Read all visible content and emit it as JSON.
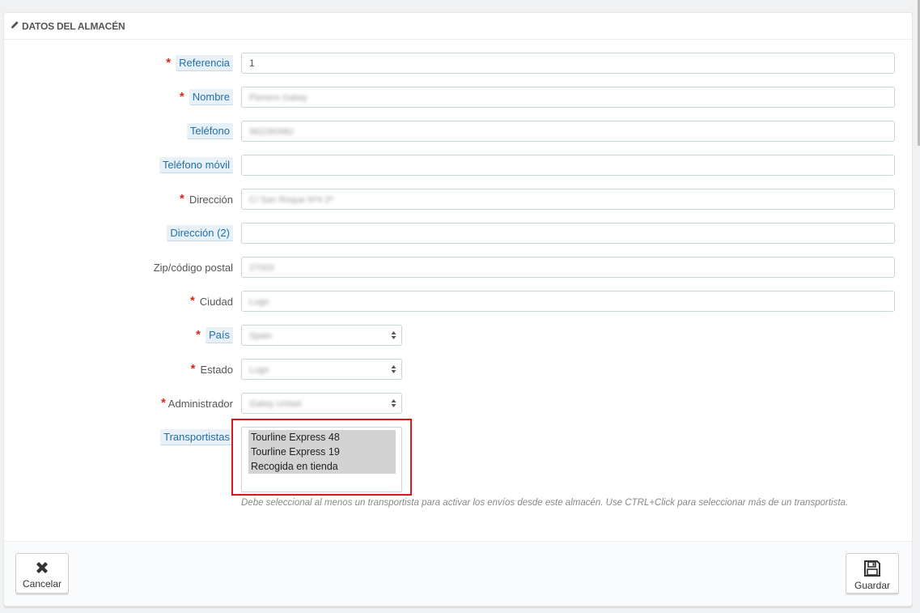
{
  "panel": {
    "title": "DATOS DEL ALMACÉN"
  },
  "fields": {
    "referencia": {
      "label": "Referencia",
      "value": "1"
    },
    "nombre": {
      "label": "Nombre",
      "value": "Pionero Galwy"
    },
    "telefono": {
      "label": "Teléfono",
      "value": "982280982"
    },
    "telefono_movil": {
      "label": "Teléfono móvil",
      "value": ""
    },
    "direccion": {
      "label": "Dirección",
      "value": "C/ San Roque Nº4 2ª"
    },
    "direccion2": {
      "label": "Dirección (2)",
      "value": ""
    },
    "zip": {
      "label": "Zip/código postal",
      "value": "27003"
    },
    "ciudad": {
      "label": "Ciudad",
      "value": "Lugo"
    },
    "pais": {
      "label": "País",
      "value": "Spain"
    },
    "estado": {
      "label": "Estado",
      "value": "Lugo"
    },
    "administrador": {
      "label": "Administrador",
      "value": "Galwy Uniset"
    },
    "transportistas": {
      "label": "Transportistas",
      "options": [
        "Tourline Express 48",
        "Tourline Express 19",
        "Recogida en tienda"
      ],
      "help": "Debe seleccional al menos un transportista para activar los envíos desde este almacén. Use CTRL+Click para seleccionar más de un transportista."
    }
  },
  "required_mark": "*",
  "footer": {
    "cancel_label": "Cancelar",
    "save_label": "Guardar"
  },
  "icons": {
    "heading": "pencil-icon",
    "cancel": "close-icon",
    "save": "floppy-disk-icon"
  },
  "colors": {
    "required": "#d9261c",
    "highlight_border": "#d9171c",
    "tooltip_label_bg": "#e8f1f8",
    "tooltip_label_text": "#1f6fa8"
  }
}
